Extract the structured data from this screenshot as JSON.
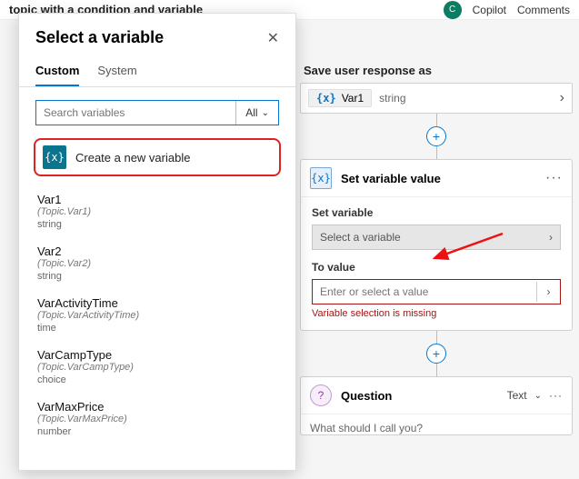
{
  "topbar": {
    "title": "topic with a condition and variable",
    "copilot": "Copilot",
    "comments": "Comments"
  },
  "popover": {
    "title": "Select a variable",
    "tabs": {
      "custom": "Custom",
      "system": "System"
    },
    "search_placeholder": "Search variables",
    "all_label": "All",
    "create_label": "Create a new variable",
    "variables": [
      {
        "name": "Var1",
        "path": "(Topic.Var1)",
        "type": "string"
      },
      {
        "name": "Var2",
        "path": "(Topic.Var2)",
        "type": "string"
      },
      {
        "name": "VarActivityTime",
        "path": "(Topic.VarActivityTime)",
        "type": "time"
      },
      {
        "name": "VarCampType",
        "path": "(Topic.VarCampType)",
        "type": "choice"
      },
      {
        "name": "VarMaxPrice",
        "path": "(Topic.VarMaxPrice)",
        "type": "number"
      }
    ]
  },
  "saveResponse": {
    "label": "Save user response as",
    "var_name": "Var1",
    "var_type": "string"
  },
  "setNode": {
    "title": "Set variable value",
    "set_label": "Set variable",
    "select_placeholder": "Select a variable",
    "to_label": "To value",
    "to_placeholder": "Enter or select a value",
    "error": "Variable selection is missing"
  },
  "questionNode": {
    "title": "Question",
    "type_label": "Text",
    "prompt": "What should I call you?"
  }
}
